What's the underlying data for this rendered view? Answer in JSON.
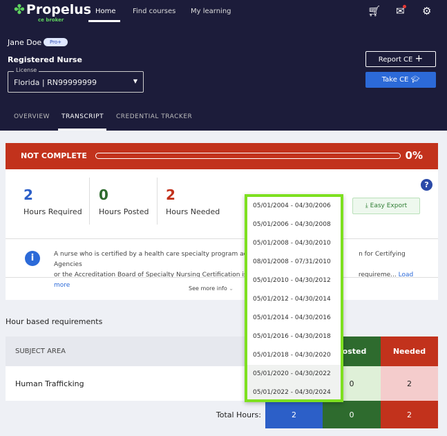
{
  "header": {
    "brand": "Propelus",
    "brand_sub": "ce broker",
    "nav": [
      "Home",
      "Find courses",
      "My learning"
    ],
    "icons": [
      "cart-icon",
      "mail-icon",
      "gear-icon"
    ],
    "user_name": "Jane Doe",
    "plan_badge": "Pro+",
    "role": "Registered Nurse",
    "license_label": "License",
    "license_value": "Florida | RN99999999",
    "report_ce": "Report CE",
    "take_ce": "Take CE",
    "tabs": [
      "OVERVIEW",
      "TRANSCRIPT",
      "CREDENTIAL TRACKER"
    ]
  },
  "status": {
    "label": "NOT COMPLETE",
    "progress_percent": 0,
    "percent_text": "0%"
  },
  "stats": [
    {
      "value": "2",
      "label": "Hours Required",
      "color": "#2c5fc8"
    },
    {
      "value": "0",
      "label": "Hours Posted",
      "color": "#2e6b2e"
    },
    {
      "value": "2",
      "label": "Hours Needed",
      "color": "#c2321c"
    }
  ],
  "export_label": "Easy Export",
  "info": {
    "line1_a": "A nurse who is certified by a health care specialty program accr",
    "line1_b": "n for Certifying Agencies",
    "line2_a": "or the Accreditation Board of Specialty Nursing Certification is e",
    "line2_b": "requireme...",
    "load_more": "Load more",
    "see_more": "See more info"
  },
  "section_title": "Hour based requirements",
  "table": {
    "headers": [
      "SUBJECT AREA",
      "",
      "Posted",
      "Needed"
    ],
    "rows": [
      {
        "subject": "Human Trafficking",
        "required": "",
        "posted": "0",
        "needed": "2"
      }
    ],
    "total_label": "Total Hours:",
    "totals": [
      "2",
      "0",
      "2"
    ]
  },
  "dropdown": {
    "options": [
      "05/01/2004 - 04/30/2006",
      "05/01/2006 - 04/30/2008",
      "05/01/2008 - 04/30/2010",
      "08/01/2008 - 07/31/2010",
      "05/01/2010 - 04/30/2012",
      "05/01/2012 - 04/30/2014",
      "05/01/2014 - 04/30/2016",
      "05/01/2016 - 04/30/2018",
      "05/01/2018 - 04/30/2020",
      "05/01/2020 - 04/30/2022",
      "05/01/2022 - 04/30/2024"
    ]
  }
}
